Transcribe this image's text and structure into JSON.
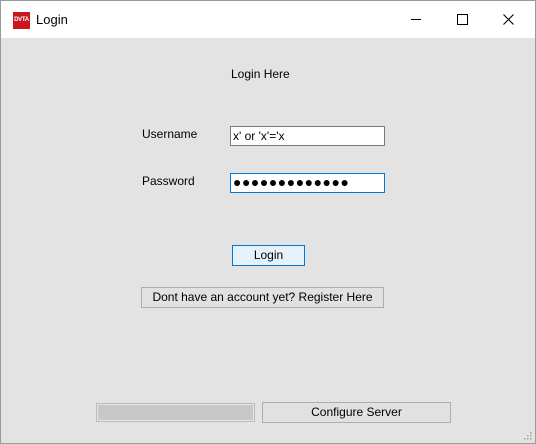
{
  "window": {
    "title": "Login",
    "app_icon_text": "DVTA",
    "close_symbol": "✕"
  },
  "form": {
    "heading": "Login Here",
    "username_label": "Username",
    "username_value": "x' or 'x'='x",
    "password_label": "Password",
    "password_display": "●●●●●●●●●●●●●"
  },
  "buttons": {
    "login": "Login",
    "register": "Dont have an account yet? Register Here",
    "configure": "Configure Server"
  },
  "progress": {
    "value": 1.0
  },
  "colors": {
    "focus_border": "#0078d7",
    "default_button_bg": "#e5f1fb",
    "app_icon_red": "#c8181e"
  }
}
